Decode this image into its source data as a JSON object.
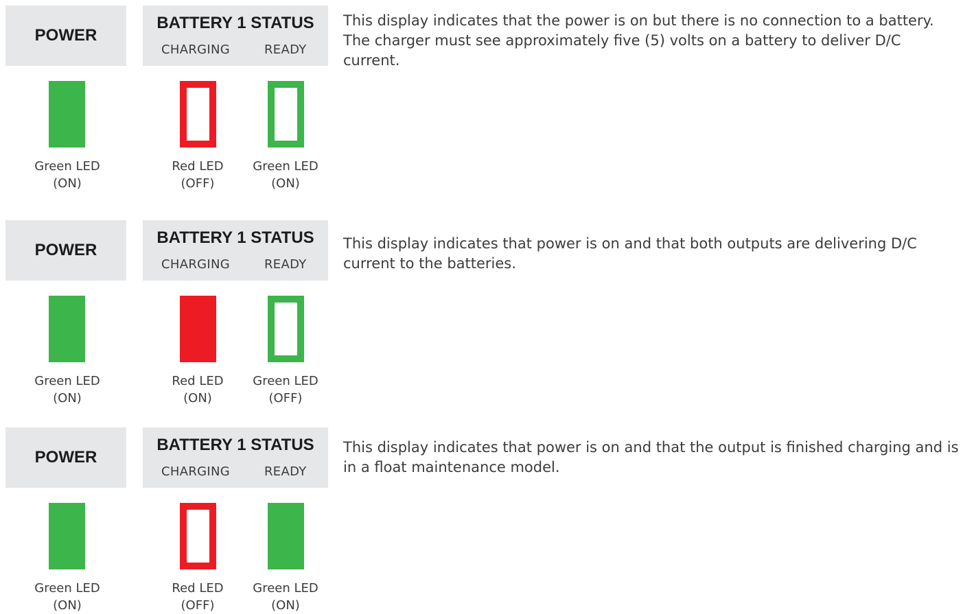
{
  "colors": {
    "header_bg": "#e6e7e8",
    "led_green": "#3cb54a",
    "led_red": "#ed1c24",
    "text": "#3c3c3c"
  },
  "panels": [
    {
      "power_label": "POWER",
      "battery_title": "BATTERY 1 STATUS",
      "charging_label": "CHARGING",
      "ready_label": "READY",
      "power_led": {
        "color": "green",
        "state": "filled",
        "caption_line1": "Green LED",
        "caption_line2": "(ON)"
      },
      "charging_led": {
        "color": "red",
        "state": "outline",
        "caption_line1": "Red LED",
        "caption_line2": "(OFF)"
      },
      "ready_led": {
        "color": "green",
        "state": "outline",
        "caption_line1": "Green LED",
        "caption_line2": "(ON)"
      },
      "description": "This display indicates that the power is on but there is no connection to a battery. The charger must see approximately five (5) volts on a battery to deliver D/C current."
    },
    {
      "power_label": "POWER",
      "battery_title": "BATTERY 1 STATUS",
      "charging_label": "CHARGING",
      "ready_label": "READY",
      "power_led": {
        "color": "green",
        "state": "filled",
        "caption_line1": "Green LED",
        "caption_line2": "(ON)"
      },
      "charging_led": {
        "color": "red",
        "state": "filled",
        "caption_line1": "Red LED",
        "caption_line2": "(ON)"
      },
      "ready_led": {
        "color": "green",
        "state": "outline",
        "caption_line1": "Green LED",
        "caption_line2": "(OFF)"
      },
      "description": "This display indicates that power is on and that both outputs are delivering D/C current to the batteries."
    },
    {
      "power_label": "POWER",
      "battery_title": "BATTERY 1 STATUS",
      "charging_label": "CHARGING",
      "ready_label": "READY",
      "power_led": {
        "color": "green",
        "state": "filled",
        "caption_line1": "Green LED",
        "caption_line2": "(ON)"
      },
      "charging_led": {
        "color": "red",
        "state": "outline",
        "caption_line1": "Red LED",
        "caption_line2": "(OFF)"
      },
      "ready_led": {
        "color": "green",
        "state": "filled",
        "caption_line1": "Green LED",
        "caption_line2": "(ON)"
      },
      "description": "This display indicates that power is on and that the output is finished charging and is in a float maintenance model."
    }
  ]
}
